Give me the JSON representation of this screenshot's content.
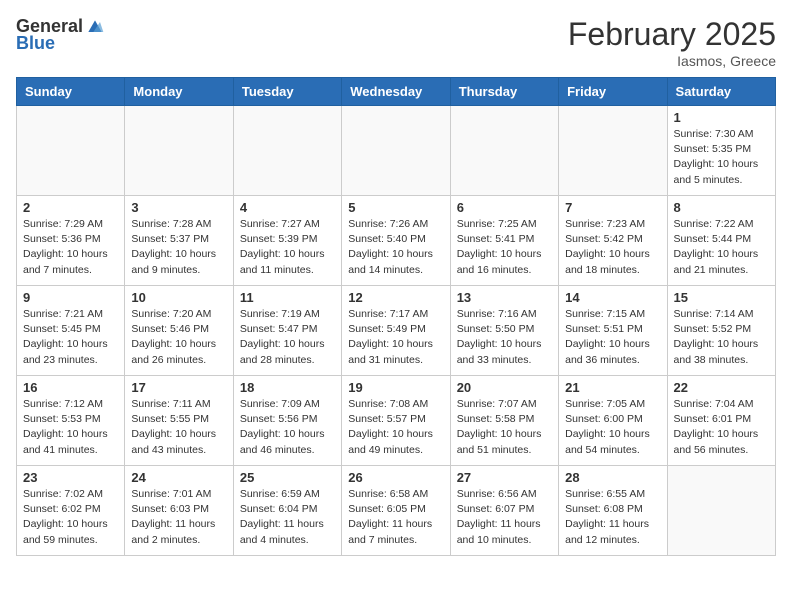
{
  "header": {
    "logo_general": "General",
    "logo_blue": "Blue",
    "month": "February 2025",
    "location": "Iasmos, Greece"
  },
  "weekdays": [
    "Sunday",
    "Monday",
    "Tuesday",
    "Wednesday",
    "Thursday",
    "Friday",
    "Saturday"
  ],
  "weeks": [
    [
      {
        "day": "",
        "info": ""
      },
      {
        "day": "",
        "info": ""
      },
      {
        "day": "",
        "info": ""
      },
      {
        "day": "",
        "info": ""
      },
      {
        "day": "",
        "info": ""
      },
      {
        "day": "",
        "info": ""
      },
      {
        "day": "1",
        "info": "Sunrise: 7:30 AM\nSunset: 5:35 PM\nDaylight: 10 hours and 5 minutes."
      }
    ],
    [
      {
        "day": "2",
        "info": "Sunrise: 7:29 AM\nSunset: 5:36 PM\nDaylight: 10 hours and 7 minutes."
      },
      {
        "day": "3",
        "info": "Sunrise: 7:28 AM\nSunset: 5:37 PM\nDaylight: 10 hours and 9 minutes."
      },
      {
        "day": "4",
        "info": "Sunrise: 7:27 AM\nSunset: 5:39 PM\nDaylight: 10 hours and 11 minutes."
      },
      {
        "day": "5",
        "info": "Sunrise: 7:26 AM\nSunset: 5:40 PM\nDaylight: 10 hours and 14 minutes."
      },
      {
        "day": "6",
        "info": "Sunrise: 7:25 AM\nSunset: 5:41 PM\nDaylight: 10 hours and 16 minutes."
      },
      {
        "day": "7",
        "info": "Sunrise: 7:23 AM\nSunset: 5:42 PM\nDaylight: 10 hours and 18 minutes."
      },
      {
        "day": "8",
        "info": "Sunrise: 7:22 AM\nSunset: 5:44 PM\nDaylight: 10 hours and 21 minutes."
      }
    ],
    [
      {
        "day": "9",
        "info": "Sunrise: 7:21 AM\nSunset: 5:45 PM\nDaylight: 10 hours and 23 minutes."
      },
      {
        "day": "10",
        "info": "Sunrise: 7:20 AM\nSunset: 5:46 PM\nDaylight: 10 hours and 26 minutes."
      },
      {
        "day": "11",
        "info": "Sunrise: 7:19 AM\nSunset: 5:47 PM\nDaylight: 10 hours and 28 minutes."
      },
      {
        "day": "12",
        "info": "Sunrise: 7:17 AM\nSunset: 5:49 PM\nDaylight: 10 hours and 31 minutes."
      },
      {
        "day": "13",
        "info": "Sunrise: 7:16 AM\nSunset: 5:50 PM\nDaylight: 10 hours and 33 minutes."
      },
      {
        "day": "14",
        "info": "Sunrise: 7:15 AM\nSunset: 5:51 PM\nDaylight: 10 hours and 36 minutes."
      },
      {
        "day": "15",
        "info": "Sunrise: 7:14 AM\nSunset: 5:52 PM\nDaylight: 10 hours and 38 minutes."
      }
    ],
    [
      {
        "day": "16",
        "info": "Sunrise: 7:12 AM\nSunset: 5:53 PM\nDaylight: 10 hours and 41 minutes."
      },
      {
        "day": "17",
        "info": "Sunrise: 7:11 AM\nSunset: 5:55 PM\nDaylight: 10 hours and 43 minutes."
      },
      {
        "day": "18",
        "info": "Sunrise: 7:09 AM\nSunset: 5:56 PM\nDaylight: 10 hours and 46 minutes."
      },
      {
        "day": "19",
        "info": "Sunrise: 7:08 AM\nSunset: 5:57 PM\nDaylight: 10 hours and 49 minutes."
      },
      {
        "day": "20",
        "info": "Sunrise: 7:07 AM\nSunset: 5:58 PM\nDaylight: 10 hours and 51 minutes."
      },
      {
        "day": "21",
        "info": "Sunrise: 7:05 AM\nSunset: 6:00 PM\nDaylight: 10 hours and 54 minutes."
      },
      {
        "day": "22",
        "info": "Sunrise: 7:04 AM\nSunset: 6:01 PM\nDaylight: 10 hours and 56 minutes."
      }
    ],
    [
      {
        "day": "23",
        "info": "Sunrise: 7:02 AM\nSunset: 6:02 PM\nDaylight: 10 hours and 59 minutes."
      },
      {
        "day": "24",
        "info": "Sunrise: 7:01 AM\nSunset: 6:03 PM\nDaylight: 11 hours and 2 minutes."
      },
      {
        "day": "25",
        "info": "Sunrise: 6:59 AM\nSunset: 6:04 PM\nDaylight: 11 hours and 4 minutes."
      },
      {
        "day": "26",
        "info": "Sunrise: 6:58 AM\nSunset: 6:05 PM\nDaylight: 11 hours and 7 minutes."
      },
      {
        "day": "27",
        "info": "Sunrise: 6:56 AM\nSunset: 6:07 PM\nDaylight: 11 hours and 10 minutes."
      },
      {
        "day": "28",
        "info": "Sunrise: 6:55 AM\nSunset: 6:08 PM\nDaylight: 11 hours and 12 minutes."
      },
      {
        "day": "",
        "info": ""
      }
    ]
  ]
}
